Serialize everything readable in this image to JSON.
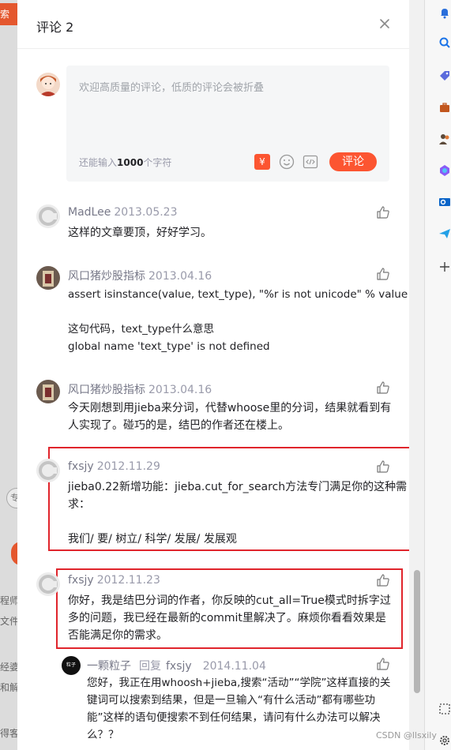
{
  "background": {
    "tag_text": "索",
    "pill_text": "专",
    "snippets": [
      "程师",
      "文件",
      "经婆",
      "和解",
      "得客"
    ]
  },
  "panel": {
    "title": "评论 2"
  },
  "editor": {
    "placeholder": "欢迎高质量的评论，低质的评论会被折叠",
    "count_prefix": "还能输入",
    "count_value": "1000",
    "count_suffix": "个字符",
    "submit_label": "评论",
    "reward_icon_text": "¥"
  },
  "comments": [
    {
      "name": "MadLee",
      "date": "2013.05.23",
      "lines": [
        "这样的文章要顶，好好学习。"
      ]
    },
    {
      "name": "风口猪炒股指标",
      "date": "2013.04.16",
      "lines": [
        "assert isinstance(value, text_type), \"%r is not unicode\" % value",
        "",
        "这句代码，text_type什么意思",
        "global name 'text_type' is not defined"
      ]
    },
    {
      "name": "风口猪炒股指标",
      "date": "2013.04.16",
      "lines": [
        "今天刚想到用jieba来分词，代替whoose里的分词，结果就看到有",
        "人实现了。碰巧的是，结巴的作者还在楼上。"
      ]
    },
    {
      "name": "fxsjy",
      "date": "2012.11.29",
      "lines": [
        "jieba0.22新增功能：jieba.cut_for_search方法专门满足你的这种需",
        "求：",
        "",
        "我们/ 要/ 树立/ 科学/ 发展/ 发展观"
      ]
    },
    {
      "name": "fxsjy",
      "date": "2012.11.23",
      "lines": [
        "你好，我是结巴分词的作者，你反映的cut_all=True模式时拆字过",
        "多的问题，我已经在最新的commit里解决了。麻烦你看看效果是",
        "否能满足你的需求。"
      ]
    }
  ],
  "reply": {
    "name": "一颗粒子",
    "reply_word": "回复",
    "target": "fxsjy",
    "date": "2014.11.04",
    "avatar_text": "粒子",
    "lines": [
      "您好，我正在用whoosh+jieba,搜索“活动”“学院”这样直接的关",
      "键词可以搜索到结果，但是一旦输入“有什么活动”都有哪些功",
      "能”这样的语句便搜索不到任何结果，请问有什么办法可以解决",
      "么？？"
    ]
  },
  "watermark": "CSDN @llsxily",
  "colors": {
    "accent": "#fc5531",
    "highlight": "#e0252c"
  }
}
